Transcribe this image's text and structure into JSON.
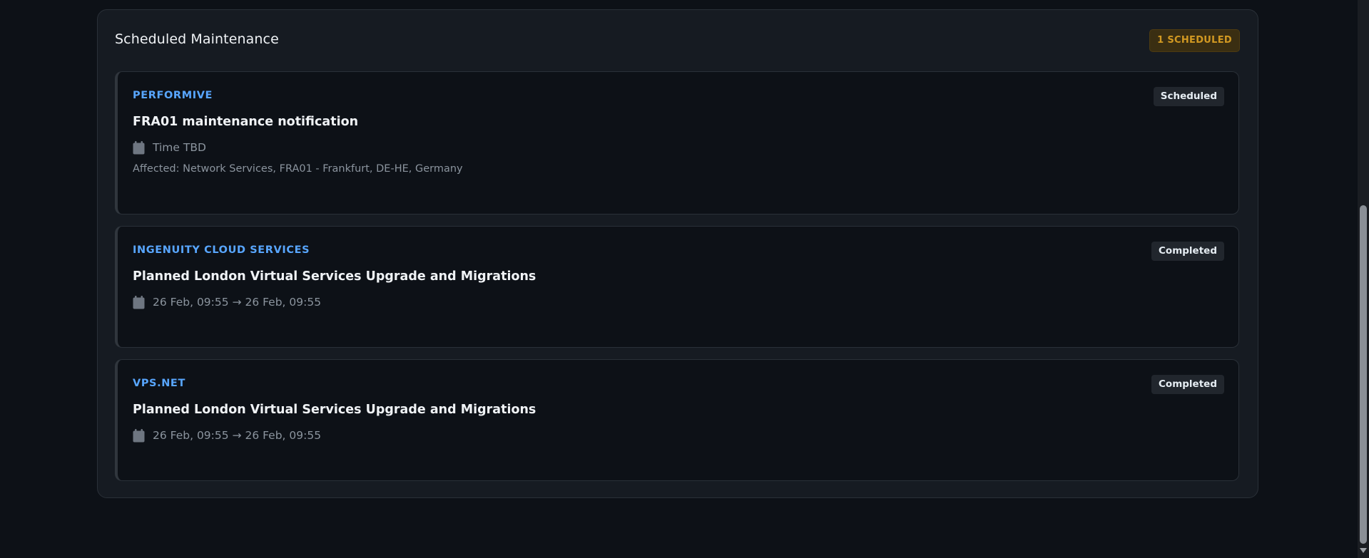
{
  "section": {
    "title": "Scheduled Maintenance",
    "count_badge": "1 SCHEDULED"
  },
  "colors": {
    "accent_provider": "#58a6ff",
    "scheduled_badge": "#d29922"
  },
  "items": [
    {
      "provider": "PERFORMIVE",
      "status": "Scheduled",
      "title": "FRA01 maintenance notification",
      "time_icon": "calendar-icon",
      "time": "Time TBD",
      "affected": "Affected: Network Services, FRA01 - Frankfurt, DE-HE, Germany"
    },
    {
      "provider": "INGENUITY CLOUD SERVICES",
      "status": "Completed",
      "title": "Planned London Virtual Services Upgrade and Migrations",
      "time_icon": "calendar-icon",
      "time": "26 Feb, 09:55 → 26 Feb, 09:55"
    },
    {
      "provider": "VPS.NET",
      "status": "Completed",
      "title": "Planned London Virtual Services Upgrade and Migrations",
      "time_icon": "calendar-icon",
      "time": "26 Feb, 09:55 → 26 Feb, 09:55"
    }
  ]
}
